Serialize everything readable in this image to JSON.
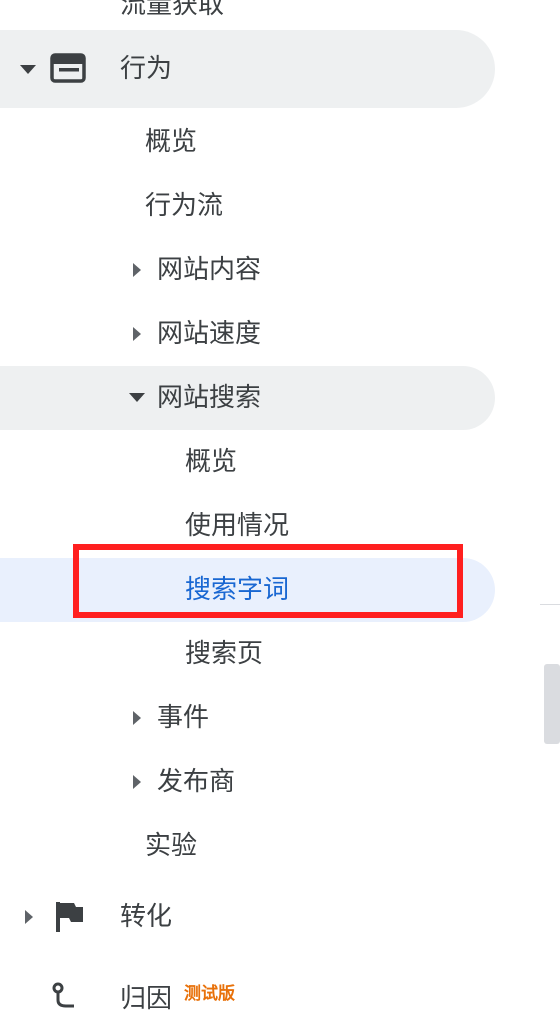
{
  "nav": {
    "top_cut_label": "流量获取",
    "behavior": {
      "label": "行为",
      "icon": "behavior-panel-icon",
      "expanded": true,
      "children": {
        "overview": "概览",
        "behavior_flow": "行为流",
        "site_content": "网站内容",
        "site_speed": "网站速度",
        "site_search": {
          "label": "网站搜索",
          "expanded": true,
          "children": {
            "overview": "概览",
            "usage": "使用情况",
            "search_terms": "搜索字词",
            "search_pages": "搜索页"
          }
        },
        "events": "事件",
        "publisher": "发布商",
        "experiments": "实验"
      }
    },
    "conversions": {
      "label": "转化",
      "icon": "flag-icon"
    },
    "attribution": {
      "label": "归因",
      "icon": "attribution-icon",
      "badge": "测试版"
    }
  },
  "colors": {
    "selected_text": "#1967d2",
    "selected_bg": "#e9f0fd",
    "expanded_bg": "#eef0f1",
    "annotation_border": "#ff1f1f",
    "beta_badge": "#e8710a"
  }
}
